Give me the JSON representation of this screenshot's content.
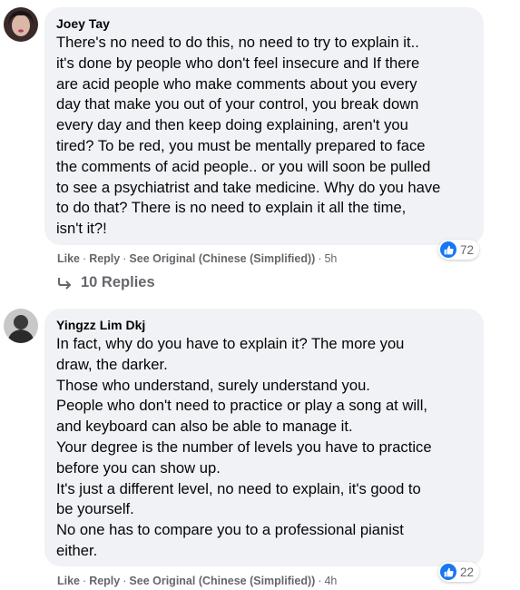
{
  "comments": [
    {
      "author": "Joey Tay",
      "text": "There's no need to do this, no need to try to explain it..\nit's done by people who don't feel insecure and If there\nare acid people who make comments about you every\nday that make you out of your control, you break down\nevery day and then keep doing explaining, aren't you\ntired? To be red, you must be mentally prepared to face\nthe comments of acid people.. or you will soon be pulled\nto see a psychiatrist and take medicine. Why do you have\nto do that? There is no need to explain it all the time,\nisn't it?!",
      "actions": {
        "like": "Like",
        "reply": "Reply",
        "see_original": "See Original (Chinese (Simplified))",
        "time": "5h"
      },
      "reaction_count": "72"
    },
    {
      "author": "Yingzz Lim Dkj",
      "text": "In fact, why do you have to explain it? The more you\ndraw, the darker.\nThose who understand, surely understand you.\nPeople who don't need to practice or play a song at will,\nand keyboard can also be able to manage it.\nYour degree is the number of levels you have to practice\nbefore you can show up.\nIt's just a different level, no need to explain, it's good to\nbe yourself.\nNo one has to compare you to a professional pianist\neither.",
      "actions": {
        "like": "Like",
        "reply": "Reply",
        "see_original": "See Original (Chinese (Simplified))",
        "time": "4h"
      },
      "reaction_count": "22"
    }
  ],
  "replies_label": "10 Replies",
  "separator": "·",
  "colors": {
    "bubble": "#f0f2f5",
    "muted": "#65676b",
    "like_blue": "#1877f2"
  },
  "icons": {
    "like": "thumbs-up-icon",
    "reply_arrow": "reply-arrow-icon"
  }
}
